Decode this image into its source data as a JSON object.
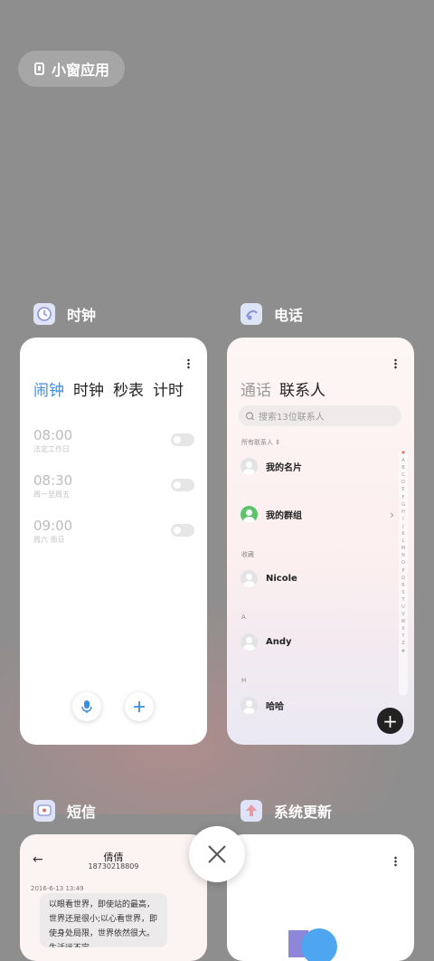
{
  "float_button": {
    "label": "小窗应用"
  },
  "apps": {
    "clock": {
      "name": "时钟",
      "tabs": [
        "闹钟",
        "时钟",
        "秒表",
        "计时"
      ],
      "alarms": [
        {
          "time": "08:00",
          "repeat": "法定工作日",
          "enabled": false
        },
        {
          "time": "08:30",
          "repeat": "周一至周五",
          "enabled": false
        },
        {
          "time": "09:00",
          "repeat": "周六 周日",
          "enabled": false
        }
      ]
    },
    "phone": {
      "name": "电话",
      "tabs": [
        "通话",
        "联系人"
      ],
      "search_placeholder": "搜索13位联系人",
      "filter_label": "所有联系人",
      "contacts": [
        {
          "name": "我的名片"
        },
        {
          "name": "我的群组"
        },
        {
          "section": "收藏",
          "name": "Nicole"
        },
        {
          "section": "A",
          "name": "Andy"
        },
        {
          "section": "H",
          "name": "哈哈"
        }
      ],
      "alphabet": [
        "♥",
        "A",
        "B",
        "C",
        "D",
        "E",
        "F",
        "G",
        "H",
        "I",
        "J",
        "K",
        "L",
        "M",
        "N",
        "O",
        "P",
        "Q",
        "R",
        "S",
        "T",
        "U",
        "V",
        "W",
        "X",
        "Y",
        "Z",
        "#"
      ]
    },
    "sms": {
      "name": "短信",
      "contact_name": "倩倩",
      "contact_number": "18730218809",
      "date": "2016-6-13 13:49",
      "message": "以眼看世界，即使站的最高，世界还是很小;以心看世界，即使身处局限，世界依然很大。生活远不完"
    },
    "update": {
      "name": "系统更新"
    }
  }
}
